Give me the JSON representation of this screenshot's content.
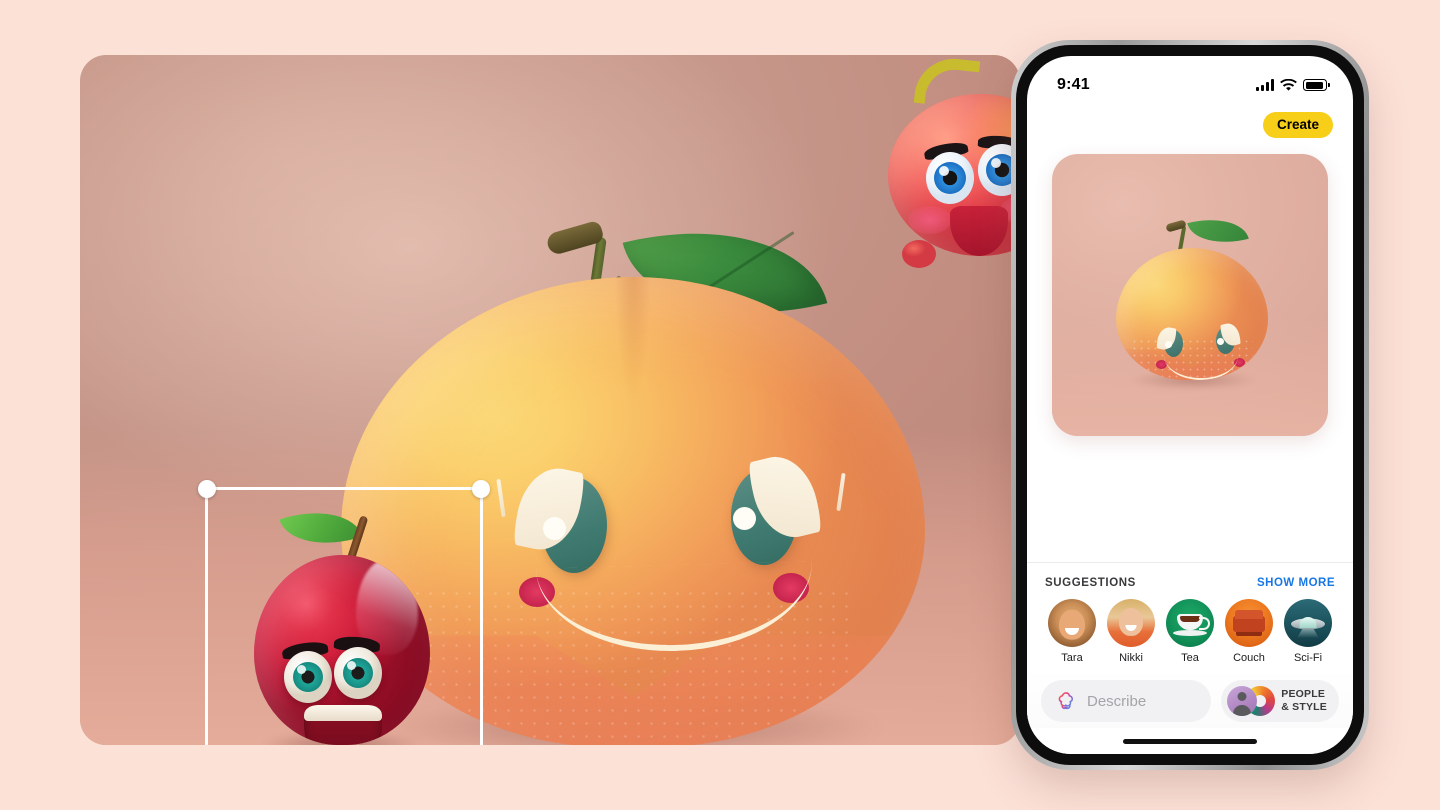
{
  "phone": {
    "status": {
      "time": "9:41",
      "cellular_icon": "cellular-bars-icon",
      "wifi_icon": "wifi-icon",
      "battery_icon": "battery-icon"
    },
    "navbar": {
      "create_label": "Create"
    },
    "preview": {
      "alt": "generated-peach-character-image"
    },
    "suggestions": {
      "title": "SUGGESTIONS",
      "show_more_label": "SHOW MORE",
      "items": [
        {
          "label": "Tara",
          "icon": "person-photo-icon",
          "color": "#c98d55"
        },
        {
          "label": "Nikki",
          "icon": "person-photo-icon",
          "color": "#e8703a"
        },
        {
          "label": "Tea",
          "icon": "teacup-icon",
          "color": "#13945a"
        },
        {
          "label": "Couch",
          "icon": "couch-icon",
          "color": "#ef7c22"
        },
        {
          "label": "Sci-Fi",
          "icon": "ufo-icon",
          "color": "#1d555f"
        }
      ]
    },
    "bottom": {
      "describe_placeholder": "Describe",
      "describe_value": "",
      "describe_icon": "image-playground-icon",
      "people_style_line1": "PEOPLE",
      "people_style_line2": "& STYLE",
      "people_icon": "person-avatar-icon",
      "style_icon": "color-wheel-icon",
      "home_indicator": "home-indicator"
    }
  },
  "canvas": {
    "main_character": "peach-character",
    "selected_character": "apple-character",
    "sticker_character": "floating-peach-sticker",
    "selection": {
      "handles": [
        "top-left",
        "top-right",
        "bottom-left",
        "bottom-right"
      ]
    }
  },
  "colors": {
    "page_background": "#fce1d7",
    "canvas_background": "#c6988b",
    "create_button": "#f7cf18",
    "show_more_link": "#1877e6",
    "selection_stroke": "#ffffff"
  }
}
